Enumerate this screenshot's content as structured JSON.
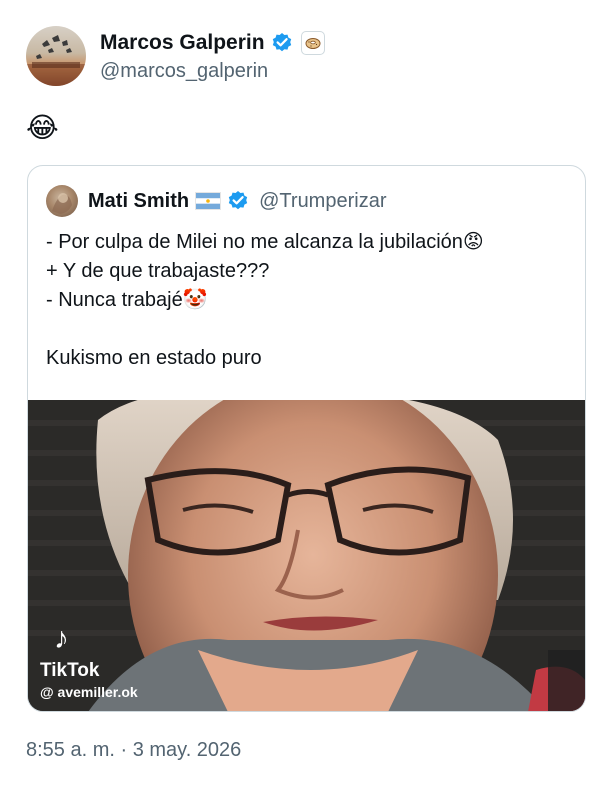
{
  "post": {
    "author_name": "Marcos Galperin",
    "author_handle": "@marcos_galperin",
    "affiliate_badge_icon": "bagel-badge-icon",
    "text": "😂",
    "timestamp": "8:55 a. m. · 3 may. 2026"
  },
  "quote": {
    "author_name": "Mati Smith",
    "author_handle": "@Trumperizar",
    "flag_icon": "argentina-flag-icon",
    "lines": [
      "- Por culpa de Milei no me alcanza la jubilación😡",
      "+ Y de que trabajaste???",
      "- Nunca trabajé🤡",
      "",
      "Kukismo en estado puro"
    ]
  },
  "media": {
    "watermark_brand": "TikTok",
    "watermark_user": "@ avemiller.ok"
  },
  "colors": {
    "text": "#0f1419",
    "secondary": "#536471",
    "verified": "#1d9bf0",
    "border": "#cfd9de"
  }
}
